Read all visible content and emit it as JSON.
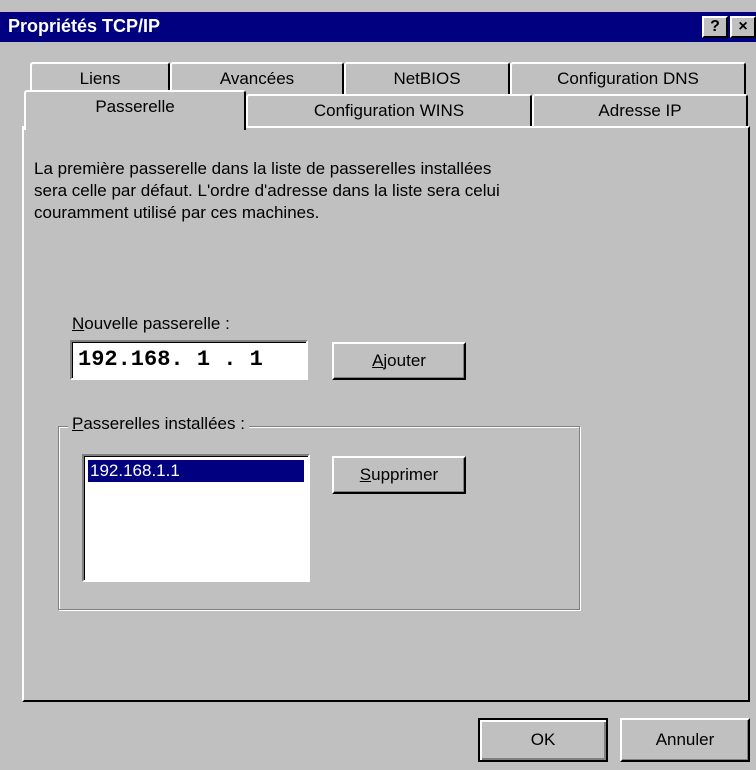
{
  "window": {
    "title": "Propriétés TCP/IP",
    "help_glyph": "?",
    "close_glyph": "×"
  },
  "tabs": {
    "row1": [
      "Liens",
      "Avancées",
      "NetBIOS",
      "Configuration DNS"
    ],
    "row2": [
      "Passerelle",
      "Configuration WINS",
      "Adresse IP"
    ],
    "active": "Passerelle"
  },
  "description": {
    "line1": "La première passerelle dans la liste de passerelles installées",
    "line2": "sera celle par défaut. L'ordre d'adresse dans la liste sera celui",
    "line3": "couramment utilisé par ces machines."
  },
  "new_gateway": {
    "label_first": "N",
    "label_rest": "ouvelle passerelle :",
    "value": "192.168. 1 . 1"
  },
  "add_button": {
    "label_first": "A",
    "label_rest": "jouter"
  },
  "installed": {
    "legend_first": "P",
    "legend_rest": "asserelles installées :",
    "items": [
      "192.168.1.1"
    ]
  },
  "remove_button": {
    "label_first": "S",
    "label_rest": "upprimer"
  },
  "footer": {
    "ok_label": "OK",
    "cancel_label": "Annuler"
  }
}
